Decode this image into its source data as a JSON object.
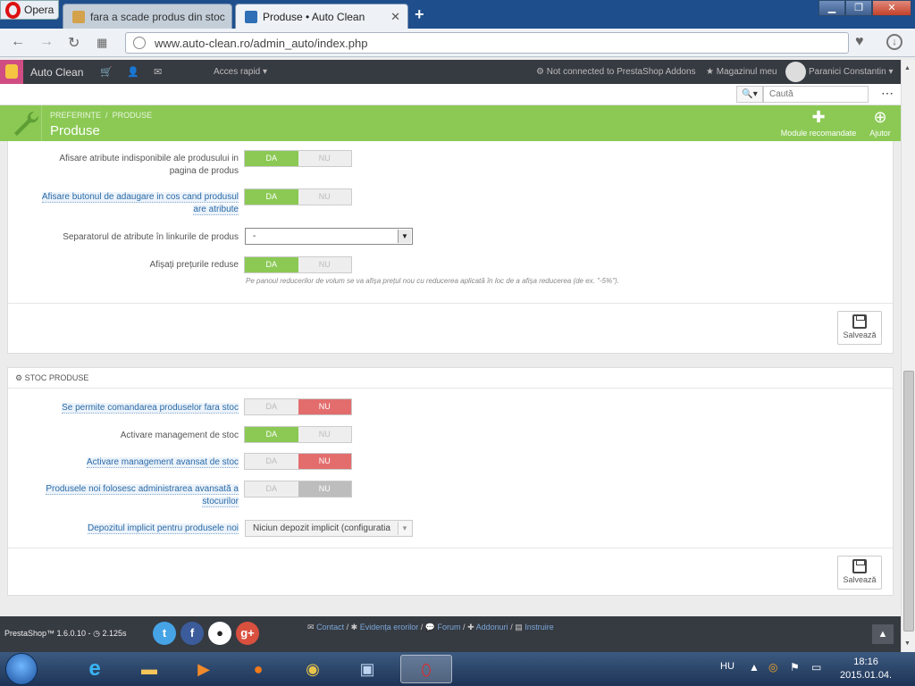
{
  "browser": {
    "app_name": "Opera",
    "tabs": [
      {
        "title": "fara a scade produs din stoc"
      },
      {
        "title": "Produse • Auto Clean"
      }
    ],
    "url": "www.auto-clean.ro/admin_auto/index.php"
  },
  "admin": {
    "shop_name": "Auto Clean",
    "quick_access": "Acces rapid",
    "addons_status": "Not connected to PrestaShop Addons",
    "my_shop": "Magazinul meu",
    "user_name": "Paranici Constantin",
    "search_placeholder": "Caută"
  },
  "toolbar": {
    "breadcrumb_1": "PREFERINȚE",
    "breadcrumb_sep": "/",
    "breadcrumb_2": "PRODUSE",
    "title": "Produse",
    "recommended_modules": "Module recomandate",
    "help": "Ajutor"
  },
  "panel1": {
    "rows": [
      {
        "label_a": "Afisare atribute indisponibile ale produsului in",
        "label_b": "pagina de produs",
        "yes": "DA",
        "no": "NU",
        "value": "yes"
      },
      {
        "label_a": "Afisare butonul de adaugare in cos cand produsul",
        "label_b": "are atribute",
        "yes": "DA",
        "no": "NU",
        "value": "yes"
      },
      {
        "label": "Separatorul de atribute în linkurile de produs",
        "select_value": "-"
      },
      {
        "label": "Afișați prețurile reduse",
        "yes": "DA",
        "no": "NU",
        "value": "yes"
      }
    ],
    "help_text": "Pe panoul reducerilor de volum se va afișa prețul nou cu reducerea aplicată în loc de a afișa reducerea (de ex. \"-5%\").",
    "save": "Salvează"
  },
  "panel2": {
    "heading": "STOC PRODUSE",
    "rows": [
      {
        "label": "Se permite comandarea produselor fara stoc",
        "yes": "DA",
        "no": "NU",
        "value": "no"
      },
      {
        "label": "Activare management de stoc",
        "yes": "DA",
        "no": "NU",
        "value": "yes"
      },
      {
        "label": "Activare management avansat de stoc",
        "yes": "DA",
        "no": "NU",
        "value": "no"
      },
      {
        "label_a": "Produsele noi folosesc administrarea avansată a",
        "label_b": "stocurilor",
        "yes": "DA",
        "no": "NU",
        "value": "no"
      },
      {
        "label": "Depozitul implicit pentru produsele noi",
        "select_value": "Niciun depozit implicit (configuratia"
      }
    ],
    "save": "Salvează"
  },
  "footer": {
    "version": "PrestaShop™ 1.6.0.10 - ",
    "load_time": "2.125s",
    "links": [
      {
        "label": "Contact"
      },
      {
        "label": "Evidența erorilor"
      },
      {
        "label": "Forum"
      },
      {
        "label": "Addonuri"
      },
      {
        "label": "Instruire"
      }
    ],
    "link_sep": "/"
  },
  "taskbar": {
    "language": "HU",
    "time": "18:16",
    "date": "2015.01.04."
  },
  "colors": {
    "toolbar_green": "#8bc954",
    "switch_no_red": "#e36d6d",
    "admin_dark": "#363a41"
  }
}
